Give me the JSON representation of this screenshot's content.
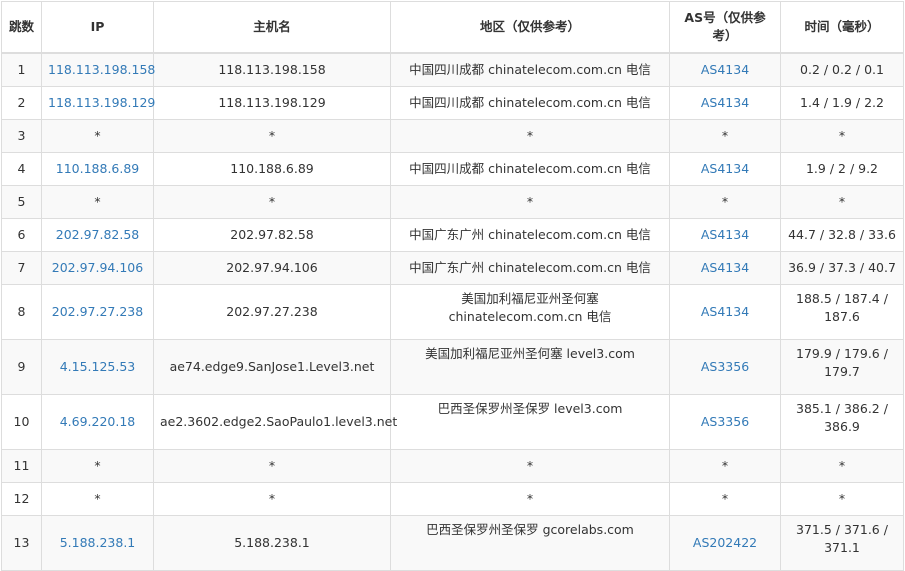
{
  "headers": {
    "hop": "跳数",
    "ip": "IP",
    "hostname": "主机名",
    "location": "地区（仅供参考）",
    "asn": "AS号（仅供参考）",
    "time": "时间（毫秒）"
  },
  "rows": [
    {
      "hop": "1",
      "ip": "118.113.198.158",
      "hostname": "118.113.198.158",
      "location": "中国四川成都 chinatelecom.com.cn 电信",
      "asn": "AS4134",
      "time": "0.2 / 0.2 / 0.1"
    },
    {
      "hop": "2",
      "ip": "118.113.198.129",
      "hostname": "118.113.198.129",
      "location": "中国四川成都 chinatelecom.com.cn 电信",
      "asn": "AS4134",
      "time": "1.4 / 1.9 / 2.2"
    },
    {
      "hop": "3",
      "ip": "*",
      "hostname": "*",
      "location": "*",
      "asn": "*",
      "time": "*"
    },
    {
      "hop": "4",
      "ip": "110.188.6.89",
      "hostname": "110.188.6.89",
      "location": "中国四川成都 chinatelecom.com.cn 电信",
      "asn": "AS4134",
      "time": "1.9 / 2 / 9.2"
    },
    {
      "hop": "5",
      "ip": "*",
      "hostname": "*",
      "location": "*",
      "asn": "*",
      "time": "*"
    },
    {
      "hop": "6",
      "ip": "202.97.82.58",
      "hostname": "202.97.82.58",
      "location": "中国广东广州 chinatelecom.com.cn 电信",
      "asn": "AS4134",
      "time": "44.7 / 32.8 / 33.6"
    },
    {
      "hop": "7",
      "ip": "202.97.94.106",
      "hostname": "202.97.94.106",
      "location": "中国广东广州 chinatelecom.com.cn 电信",
      "asn": "AS4134",
      "time": "36.9 / 37.3 / 40.7"
    },
    {
      "hop": "8",
      "ip": "202.97.27.238",
      "hostname": "202.97.27.238",
      "location": "美国加利福尼亚州圣何塞 chinatelecom.com.cn 电信",
      "asn": "AS4134",
      "time": "188.5 / 187.4 / 187.6"
    },
    {
      "hop": "9",
      "ip": "4.15.125.53",
      "hostname": "ae74.edge9.SanJose1.Level3.net",
      "location": "美国加利福尼亚州圣何塞 level3.com",
      "asn": "AS3356",
      "time": "179.9 / 179.6 / 179.7"
    },
    {
      "hop": "10",
      "ip": "4.69.220.18",
      "hostname": "ae2.3602.edge2.SaoPaulo1.level3.net",
      "location": "巴西圣保罗州圣保罗 level3.com",
      "asn": "AS3356",
      "time": "385.1 / 386.2 / 386.9"
    },
    {
      "hop": "11",
      "ip": "*",
      "hostname": "*",
      "location": "*",
      "asn": "*",
      "time": "*"
    },
    {
      "hop": "12",
      "ip": "*",
      "hostname": "*",
      "location": "*",
      "asn": "*",
      "time": "*"
    },
    {
      "hop": "13",
      "ip": "5.188.238.1",
      "hostname": "5.188.238.1",
      "location": "巴西圣保罗州圣保罗 gcorelabs.com",
      "asn": "AS202422",
      "time": "371.5 / 371.6 / 371.1"
    }
  ],
  "colors": {
    "link": "#337ab7",
    "text": "#333333",
    "border": "#dddddd",
    "stripe": "#f9f9f9"
  }
}
